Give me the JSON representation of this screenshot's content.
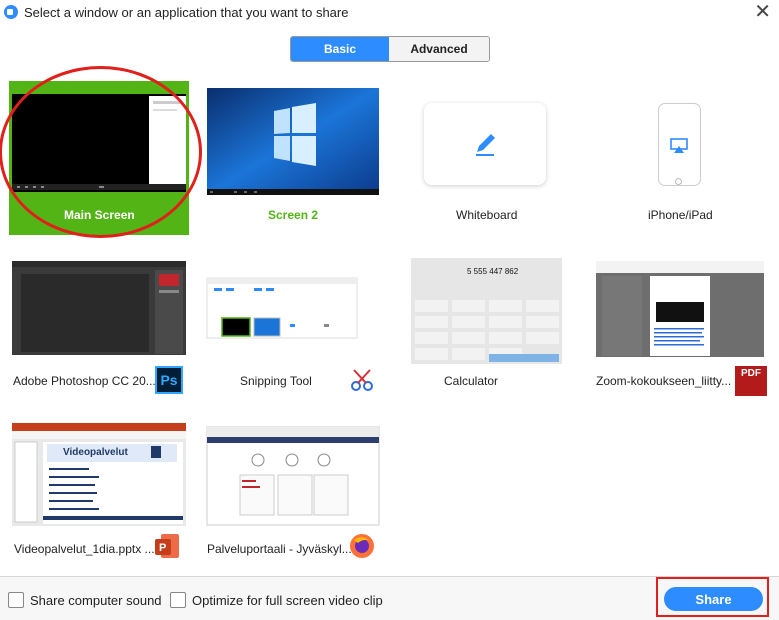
{
  "window": {
    "title": "Select a window or an application that you want to share",
    "close_glyph": "✕"
  },
  "tabs": {
    "basic": "Basic",
    "advanced": "Advanced",
    "active": "Basic"
  },
  "tiles": [
    {
      "label": "Main Screen",
      "selected": true,
      "icon": "monitor-screen"
    },
    {
      "label": "Screen 2",
      "icon": "windows-desktop"
    },
    {
      "label": "Whiteboard",
      "icon": "pencil-icon"
    },
    {
      "label": "iPhone/iPad",
      "icon": "airplay-icon"
    },
    {
      "label": "Adobe Photoshop CC 20...",
      "icon": "photoshop-icon",
      "badge": "Ps"
    },
    {
      "label": "Snipping Tool",
      "icon": "scissors-icon"
    },
    {
      "label": "Calculator",
      "icon": "calculator-window",
      "display": "5 555 447 862"
    },
    {
      "label": "Zoom-kokoukseen_liitty...",
      "icon": "pdf-icon",
      "badge": "PDF"
    },
    {
      "label": "Videopalvelut_1dia.pptx ...",
      "icon": "powerpoint-icon",
      "slide_title": "Videopalvelut"
    },
    {
      "label": "Palveluportaali - Jyväskyl...",
      "icon": "firefox-icon"
    }
  ],
  "footer": {
    "share_sound_label": "Share computer sound",
    "share_sound_checked": false,
    "optimize_label": "Optimize for full screen video clip",
    "optimize_checked": false,
    "share_button": "Share"
  },
  "colors": {
    "accent": "#2d8cff",
    "selected": "#53b416",
    "annotation": "#e0201c"
  }
}
